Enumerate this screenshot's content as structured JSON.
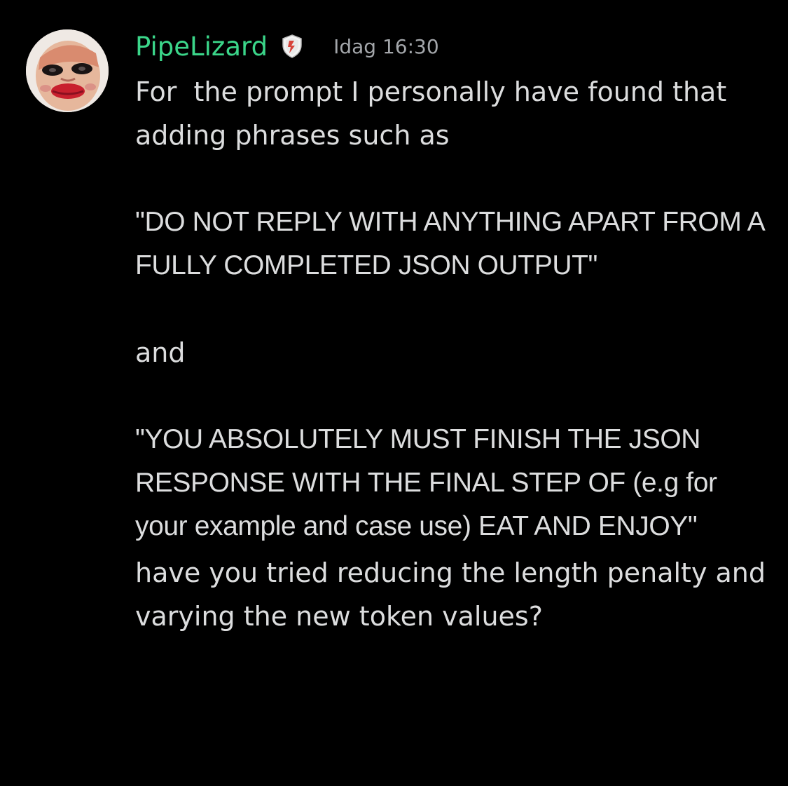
{
  "colors": {
    "background": "#000000",
    "username": "#3bd68a",
    "text": "#dcddde",
    "timestamp": "#a3a6aa"
  },
  "message": {
    "author": "PipeLizard",
    "role_icon": "shield-badge-icon",
    "timestamp": "Idag 16:30",
    "paragraphs": [
      "For  the prompt I personally have found that adding phrases such as",
      "\"DO NOT REPLY WITH ANYTHING APART FROM A FULLY COMPLETED JSON OUTPUT\"",
      "and",
      "\"YOU ABSOLUTELY MUST FINISH THE JSON RESPONSE WITH THE FINAL STEP OF (e.g for your example and case use) EAT AND ENJOY\"",
      "have you tried reducing the length penalty and varying the new token values?"
    ]
  }
}
